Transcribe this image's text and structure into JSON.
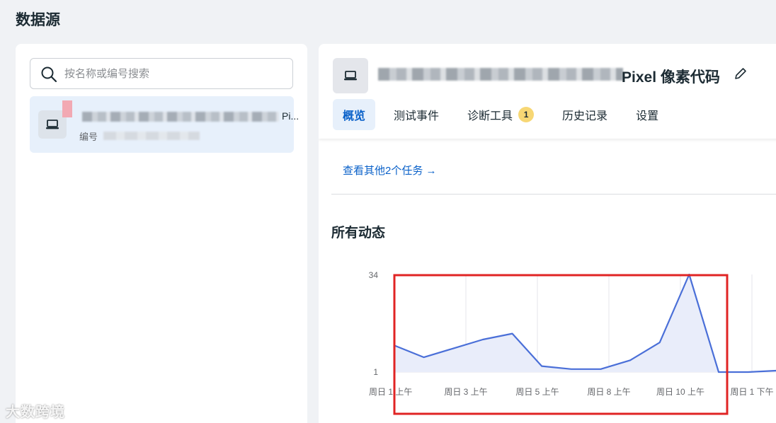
{
  "page": {
    "title": "数据源"
  },
  "sidebar": {
    "search": {
      "placeholder": "按名称或编号搜索",
      "value": ""
    },
    "items": [
      {
        "name_suffix": "Pi...",
        "id_label": "编号",
        "icon": "laptop-icon"
      }
    ]
  },
  "detail": {
    "title": "Pixel 像素代码",
    "icon": "laptop-icon",
    "edit_icon": "pencil-icon",
    "tabs": [
      {
        "label": "概览",
        "active": true
      },
      {
        "label": "测试事件"
      },
      {
        "label": "诊断工具",
        "badge": "1"
      },
      {
        "label": "历史记录"
      },
      {
        "label": "设置"
      }
    ],
    "link": "查看其他2个任务",
    "link_arrow": "→",
    "section_title": "所有动态"
  },
  "chart_data": {
    "type": "area",
    "y_ticks": [
      "34",
      "1"
    ],
    "ylim": [
      1,
      34
    ],
    "x_tick_labels": [
      "周日 1 上午",
      "周日 3 上午",
      "周日 5 上午",
      "周日 8 上午",
      "周日 10 上午",
      "周日 1 下午"
    ],
    "values": [
      10,
      6,
      9,
      12,
      14,
      3,
      2,
      2,
      5,
      11,
      34,
      1,
      1,
      1.5
    ],
    "color": "#4a6fd8",
    "highlight_box_color": "#e02424"
  },
  "watermark": "大数跨境"
}
